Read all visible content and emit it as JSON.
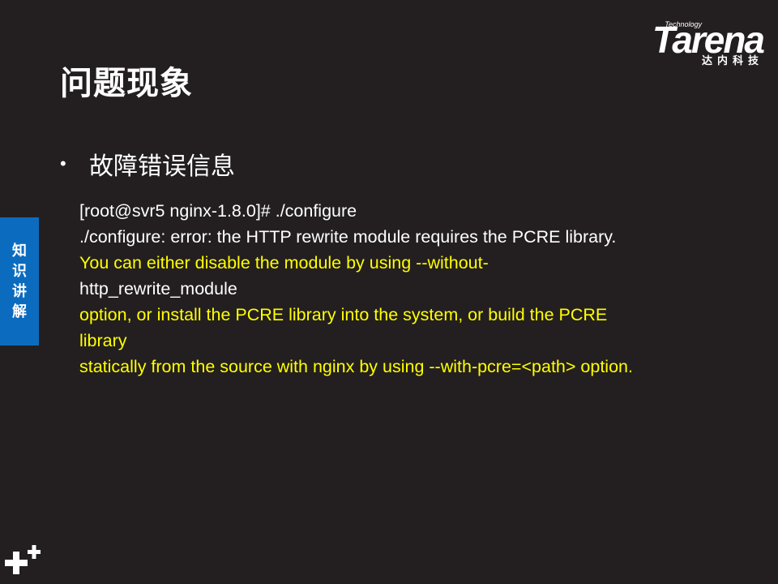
{
  "logo": {
    "small_text": "Technology",
    "wordmark": "Tarena",
    "chinese_text": "达内科技"
  },
  "slide": {
    "title": "问题现象",
    "bullet_text": "故障错误信息"
  },
  "side_tab": {
    "chars": [
      "知",
      "识",
      "讲",
      "解"
    ],
    "color": "#0b6cbf"
  },
  "terminal": {
    "lines": [
      {
        "text": "[root@svr5 nginx-1.8.0]# ./configure",
        "color": "white"
      },
      {
        "text": "./configure: error: the HTTP rewrite module requires the PCRE library.",
        "color": "white"
      },
      {
        "text": "You can either disable the module by using --without-",
        "color": "yellow"
      },
      {
        "text": "http_rewrite_module",
        "color": "white"
      },
      {
        "text": "option, or install the PCRE library into the system, or build the PCRE",
        "color": "yellow"
      },
      {
        "text": "library",
        "color": "yellow"
      },
      {
        "text": "statically from the source with nginx by using --with-pcre=<path> option.",
        "color": "yellow"
      }
    ]
  },
  "colors": {
    "background": "#231f20",
    "accent": "#0b6cbf",
    "highlight": "#ffff00",
    "text": "#ffffff"
  },
  "icons": {
    "corner": "plus-icon"
  }
}
